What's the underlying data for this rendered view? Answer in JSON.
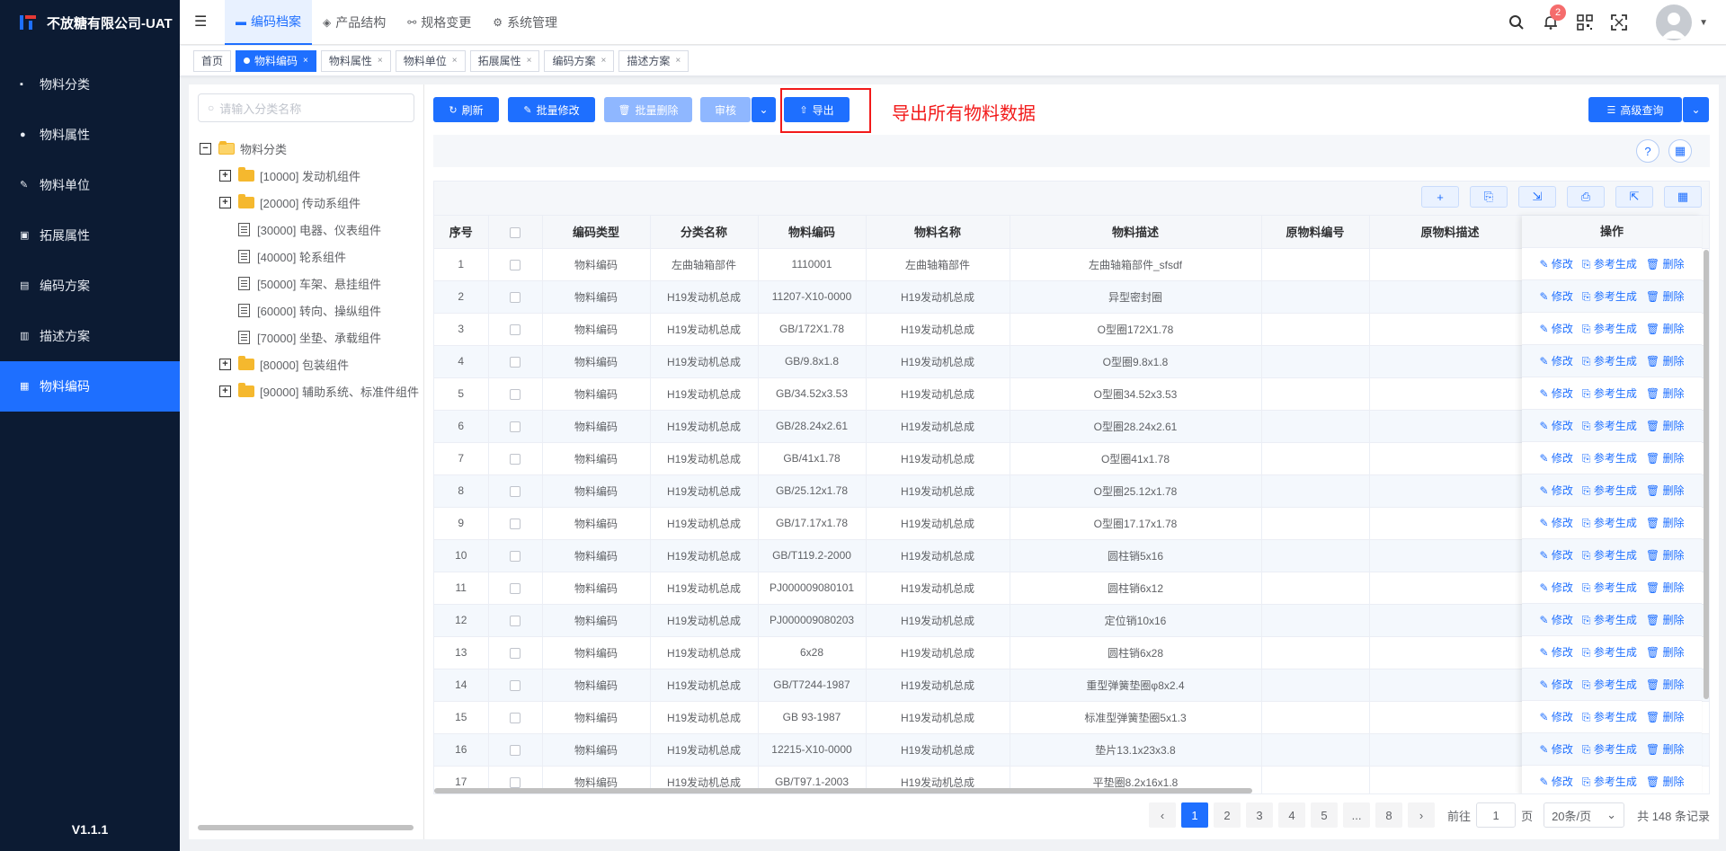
{
  "app": {
    "title": "不放糖有限公司-UAT",
    "version": "V1.1.1"
  },
  "sidebar": {
    "items": [
      {
        "label": "物料分类",
        "icon": "grid-icon"
      },
      {
        "label": "物料属性",
        "icon": "info-icon"
      },
      {
        "label": "物料单位",
        "icon": "wrench-icon"
      },
      {
        "label": "拓展属性",
        "icon": "image-icon"
      },
      {
        "label": "编码方案",
        "icon": "book-icon"
      },
      {
        "label": "描述方案",
        "icon": "document-icon"
      },
      {
        "label": "物料编码",
        "icon": "file-icon",
        "active": true
      }
    ]
  },
  "header": {
    "nav": [
      {
        "label": "编码档案",
        "active": true
      },
      {
        "label": "产品结构"
      },
      {
        "label": "规格变更"
      },
      {
        "label": "系统管理"
      }
    ],
    "notification_count": "2"
  },
  "tags": [
    {
      "label": "首页"
    },
    {
      "label": "物料编码",
      "active": true
    },
    {
      "label": "物料属性"
    },
    {
      "label": "物料单位"
    },
    {
      "label": "拓展属性"
    },
    {
      "label": "编码方案"
    },
    {
      "label": "描述方案"
    }
  ],
  "tree": {
    "search_placeholder": "请输入分类名称",
    "root": "物料分类",
    "nodes": [
      {
        "label": "[10000] 发动机组件",
        "type": "folder"
      },
      {
        "label": "[20000] 传动系组件",
        "type": "folder"
      },
      {
        "label": "[30000] 电器、仪表组件",
        "type": "leaf"
      },
      {
        "label": "[40000] 轮系组件",
        "type": "leaf"
      },
      {
        "label": "[50000] 车架、悬挂组件",
        "type": "leaf"
      },
      {
        "label": "[60000] 转向、操纵组件",
        "type": "leaf"
      },
      {
        "label": "[70000] 坐垫、承载组件",
        "type": "leaf"
      },
      {
        "label": "[80000] 包装组件",
        "type": "folder"
      },
      {
        "label": "[90000] 辅助系统、标准件组件",
        "type": "folder"
      }
    ]
  },
  "toolbar": {
    "refresh": "刷新",
    "batch_edit": "批量修改",
    "batch_delete": "批量删除",
    "review": "审核",
    "export": "导出",
    "advanced_query": "高级查询",
    "annotation": "导出所有物料数据"
  },
  "table": {
    "columns": [
      "序号",
      "",
      "编码类型",
      "分类名称",
      "物料编码",
      "物料名称",
      "物料描述",
      "原物料编号",
      "原物料描述",
      "操作"
    ],
    "op_labels": {
      "edit": "修改",
      "ref": "参考生成",
      "delete": "删除"
    },
    "rows": [
      [
        "1",
        "物料编码",
        "左曲轴箱部件",
        "1110001",
        "左曲轴箱部件",
        "左曲轴箱部件_sfsdf"
      ],
      [
        "2",
        "物料编码",
        "H19发动机总成",
        "11207-X10-0000",
        "H19发动机总成",
        "异型密封圈"
      ],
      [
        "3",
        "物料编码",
        "H19发动机总成",
        "GB/172X1.78",
        "H19发动机总成",
        "O型圈172X1.78"
      ],
      [
        "4",
        "物料编码",
        "H19发动机总成",
        "GB/9.8x1.8",
        "H19发动机总成",
        "O型圈9.8x1.8"
      ],
      [
        "5",
        "物料编码",
        "H19发动机总成",
        "GB/34.52x3.53",
        "H19发动机总成",
        "O型圈34.52x3.53"
      ],
      [
        "6",
        "物料编码",
        "H19发动机总成",
        "GB/28.24x2.61",
        "H19发动机总成",
        "O型圈28.24x2.61"
      ],
      [
        "7",
        "物料编码",
        "H19发动机总成",
        "GB/41x1.78",
        "H19发动机总成",
        "O型圈41x1.78"
      ],
      [
        "8",
        "物料编码",
        "H19发动机总成",
        "GB/25.12x1.78",
        "H19发动机总成",
        "O型圈25.12x1.78"
      ],
      [
        "9",
        "物料编码",
        "H19发动机总成",
        "GB/17.17x1.78",
        "H19发动机总成",
        "O型圈17.17x1.78"
      ],
      [
        "10",
        "物料编码",
        "H19发动机总成",
        "GB/T119.2-2000",
        "H19发动机总成",
        "圆柱销5x16"
      ],
      [
        "11",
        "物料编码",
        "H19发动机总成",
        "PJ000009080101",
        "H19发动机总成",
        "圆柱销6x12"
      ],
      [
        "12",
        "物料编码",
        "H19发动机总成",
        "PJ000009080203",
        "H19发动机总成",
        "定位销10x16"
      ],
      [
        "13",
        "物料编码",
        "H19发动机总成",
        "6x28",
        "H19发动机总成",
        "圆柱销6x28"
      ],
      [
        "14",
        "物料编码",
        "H19发动机总成",
        "GB/T7244-1987",
        "H19发动机总成",
        "重型弹簧垫圈φ8x2.4"
      ],
      [
        "15",
        "物料编码",
        "H19发动机总成",
        "GB 93-1987",
        "H19发动机总成",
        "标准型弹簧垫圈5x1.3"
      ],
      [
        "16",
        "物料编码",
        "H19发动机总成",
        "12215-X10-0000",
        "H19发动机总成",
        "垫片13.1x23x3.8"
      ],
      [
        "17",
        "物料编码",
        "H19发动机总成",
        "GB/T97.1-2003",
        "H19发动机总成",
        "平垫圈8.2x16x1.8"
      ]
    ]
  },
  "pagination": {
    "pages": [
      "1",
      "2",
      "3",
      "4",
      "5",
      "...",
      "8"
    ],
    "current": "1",
    "goto_label": "前往",
    "goto_value": "1",
    "page_unit": "页",
    "page_size": "20条/页",
    "total": "共 148 条记录"
  }
}
